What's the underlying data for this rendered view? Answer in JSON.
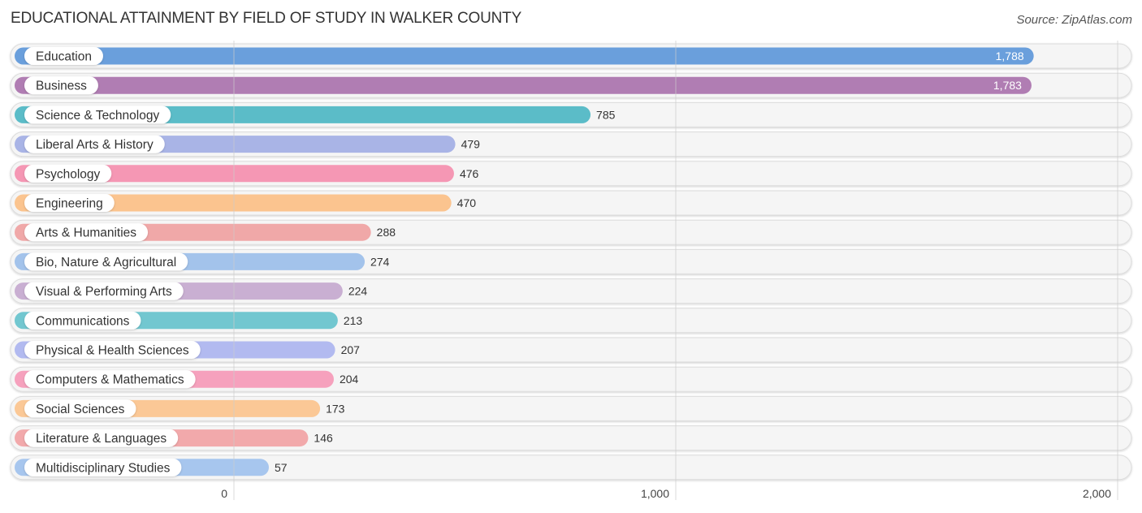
{
  "chart_data": {
    "type": "bar",
    "orientation": "horizontal",
    "title": "EDUCATIONAL ATTAINMENT BY FIELD OF STUDY IN WALKER COUNTY",
    "source": "Source: ZipAtlas.com",
    "xlabel": "",
    "ylabel": "",
    "xlim": [
      0,
      2000
    ],
    "xticks": [
      0,
      1000,
      2000
    ],
    "xtick_labels": [
      "0",
      "1,000",
      "2,000"
    ],
    "grid": true,
    "categories": [
      "Education",
      "Business",
      "Science & Technology",
      "Liberal Arts & History",
      "Psychology",
      "Engineering",
      "Arts & Humanities",
      "Bio, Nature & Agricultural",
      "Visual & Performing Arts",
      "Communications",
      "Physical & Health Sciences",
      "Computers & Mathematics",
      "Social Sciences",
      "Literature & Languages",
      "Multidisciplinary Studies"
    ],
    "values": [
      1788,
      1783,
      785,
      479,
      476,
      470,
      288,
      274,
      224,
      213,
      207,
      204,
      173,
      146,
      57
    ],
    "value_labels": [
      "1,788",
      "1,783",
      "785",
      "479",
      "476",
      "470",
      "288",
      "274",
      "224",
      "213",
      "207",
      "204",
      "173",
      "146",
      "57"
    ],
    "colors": [
      "#6a9fdc",
      "#b07db3",
      "#5bbcc8",
      "#a9b4e6",
      "#f597b4",
      "#fbc48f",
      "#f0a8a8",
      "#a3c3eb",
      "#c9afd2",
      "#72c7d0",
      "#b2baf0",
      "#f6a1bd",
      "#fbc896",
      "#f2a9ab",
      "#a7c6ee"
    ]
  }
}
